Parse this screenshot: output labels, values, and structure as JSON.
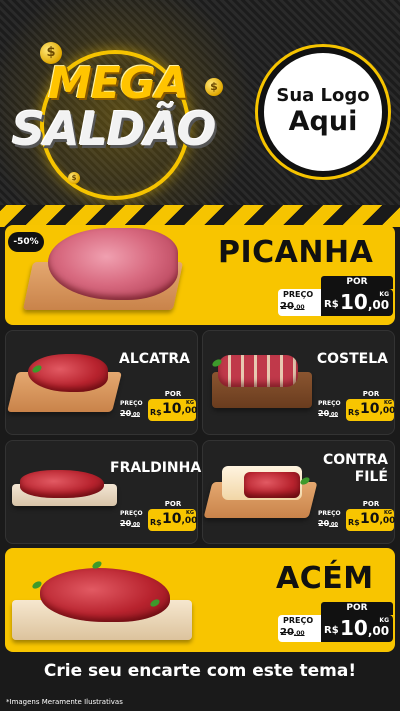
{
  "header": {
    "title_line1": "MEGA",
    "title_line2": "SALDÃO",
    "coin_symbol": "$",
    "logo_line1": "Sua Logo",
    "logo_line2": "Aqui"
  },
  "colors": {
    "accent_yellow": "#f8c500",
    "dark": "#111111",
    "panel_dark": "#222222"
  },
  "featured_top": {
    "discount_badge": "-50%",
    "name": "PICANHA",
    "por": "POR",
    "preco": "PREÇO",
    "old_price": "20",
    "old_cents": ",00",
    "currency": "R$",
    "price": "10",
    "cents": ",00",
    "unit": "KG"
  },
  "products": [
    {
      "name": "ALCATRA",
      "por": "POR",
      "preco": "PREÇO",
      "old_price": "20",
      "old_cents": ",00",
      "currency": "R$",
      "price": "10",
      "cents": ",00",
      "unit": "KG"
    },
    {
      "name": "COSTELA",
      "por": "POR",
      "preco": "PREÇO",
      "old_price": "20",
      "old_cents": ",00",
      "currency": "R$",
      "price": "10",
      "cents": ",00",
      "unit": "KG"
    },
    {
      "name": "FRALDINHA",
      "por": "POR",
      "preco": "PREÇO",
      "old_price": "20",
      "old_cents": ",00",
      "currency": "R$",
      "price": "10",
      "cents": ",00",
      "unit": "KG"
    },
    {
      "name_line1": "CONTRA",
      "name_line2": "FILÉ",
      "por": "POR",
      "preco": "PREÇO",
      "old_price": "20",
      "old_cents": ",00",
      "currency": "R$",
      "price": "10",
      "cents": ",00",
      "unit": "KG"
    }
  ],
  "featured_bottom": {
    "name": "ACÉM",
    "por": "POR",
    "preco": "PREÇO",
    "old_price": "20",
    "old_cents": ",00",
    "currency": "R$",
    "price": "10",
    "cents": ",00",
    "unit": "KG"
  },
  "footer": {
    "title": "Crie seu encarte com este tema!",
    "note": "*Imagens Meramente Ilustrativas"
  }
}
